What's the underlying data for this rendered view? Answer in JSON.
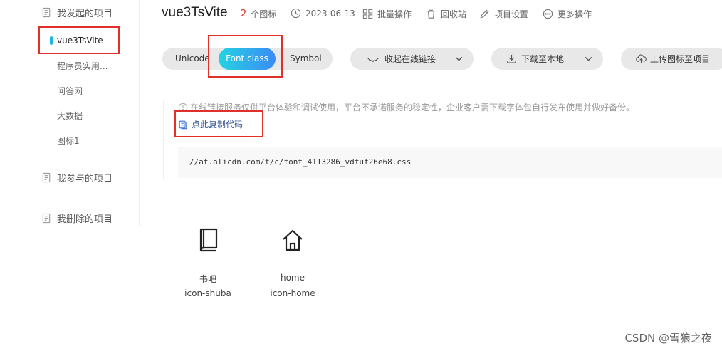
{
  "sidebar": {
    "my_projects": "我发起的项目",
    "items": [
      {
        "label": "vue3TsVite"
      },
      {
        "label": "程序员实用..."
      },
      {
        "label": "问答网"
      },
      {
        "label": "大数据"
      },
      {
        "label": "图标1"
      }
    ],
    "joined_projects": "我参与的项目",
    "deleted_projects": "我删除的项目"
  },
  "header": {
    "title": "vue3TsVite",
    "icon_count": "2",
    "icon_count_label": "个图标",
    "date": "2023-06-13",
    "batch_ops": "批量操作",
    "recycle_bin": "回收站",
    "project_settings": "项目设置",
    "more_ops": "更多操作"
  },
  "tabs": {
    "unicode": "Unicode",
    "font_class": "Font class",
    "symbol": "Symbol"
  },
  "actions": {
    "collapse_link": "收起在线链接",
    "download": "下载至本地",
    "upload": "上传图标至项目"
  },
  "notice": {
    "text": "在线链接服务仅供平台体验和调试使用，平台不承诺服务的稳定性，企业客户需下载字体包自行发布使用并做好备份。",
    "copy_code": "点此复制代码",
    "css_url": "//at.alicdn.com/t/c/font_4113286_vdfuf26e68.css"
  },
  "icons": [
    {
      "name": "书吧",
      "class": "icon-shuba",
      "icon": "book-icon"
    },
    {
      "name": "home",
      "class": "icon-home",
      "icon": "home-icon"
    }
  ],
  "watermark": "CSDN @雪狼之夜",
  "colors": {
    "accent_gradient_start": "#25d3e3",
    "accent_gradient_end": "#3b8bf5",
    "highlight_red": "#e0302a",
    "active_bar": "#1bb7e4"
  }
}
